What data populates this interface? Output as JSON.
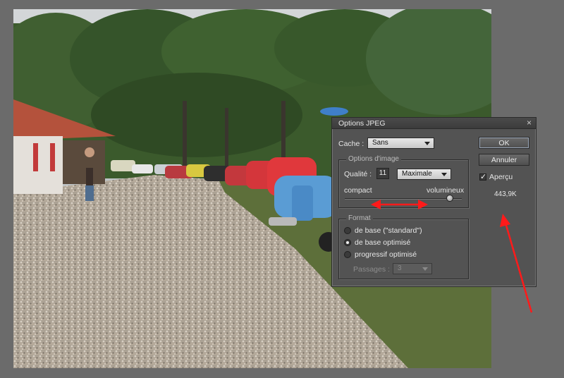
{
  "dialog": {
    "title": "Options JPEG",
    "close_glyph": "×",
    "cache_label": "Cache :",
    "cache_value": "Sans",
    "image_options": {
      "group_title": "Options d'image",
      "quality_label": "Qualité :",
      "quality_value": "11",
      "quality_preset": "Maximale",
      "slider_left_label": "compact",
      "slider_right_label": "volumineux",
      "slider_level_fraction": 0.9
    },
    "format": {
      "group_title": "Format",
      "options": [
        {
          "label": "de base (\"standard\")",
          "selected": false
        },
        {
          "label": "de base optimisé",
          "selected": true
        },
        {
          "label": "progressif optimisé",
          "selected": false
        }
      ],
      "passes_label": "Passages :",
      "passes_value": "3"
    },
    "ok_label": "OK",
    "cancel_label": "Annuler",
    "preview_label": "Aperçu",
    "preview_checked": true,
    "file_size": "443,9K"
  },
  "annotation_color": "#ff1a1a"
}
